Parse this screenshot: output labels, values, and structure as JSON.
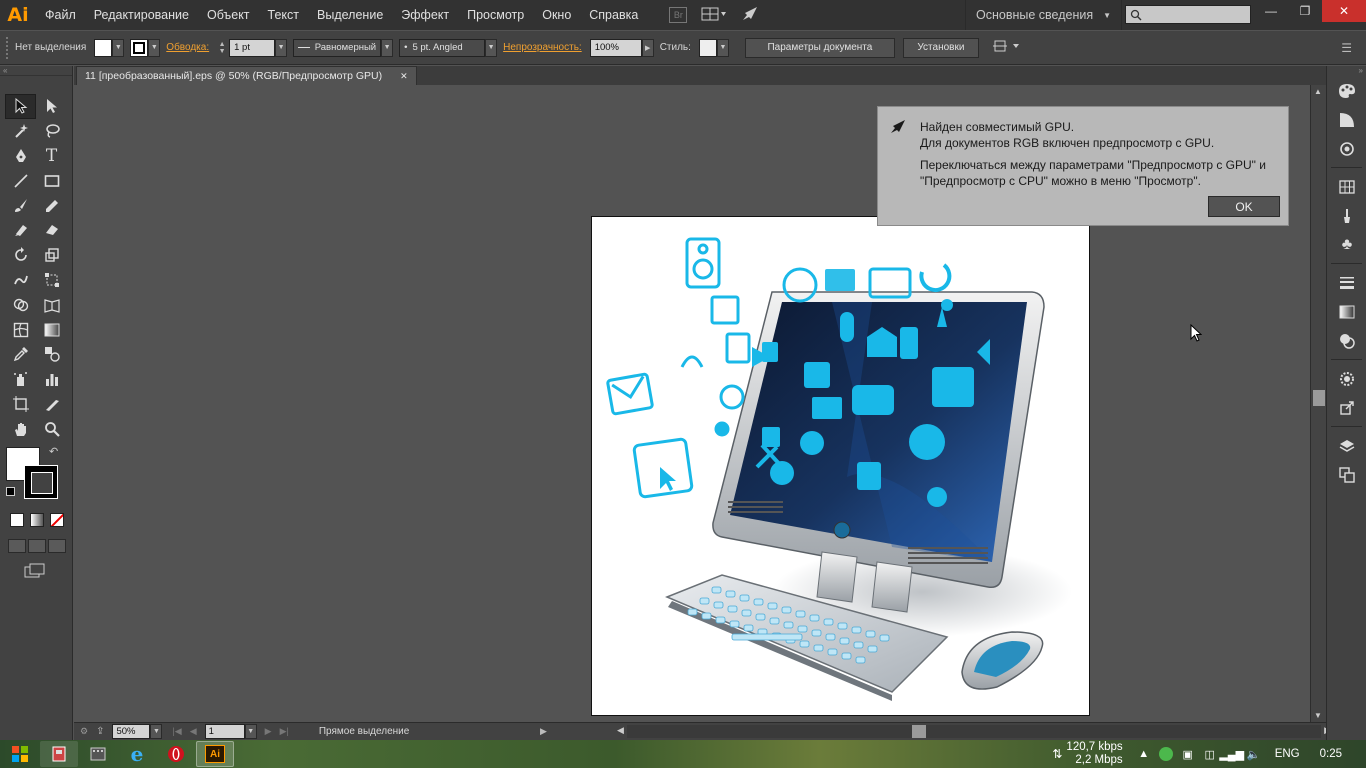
{
  "app": {
    "logo": "Ai",
    "menu": [
      "Файл",
      "Редактирование",
      "Объект",
      "Текст",
      "Выделение",
      "Эффект",
      "Просмотр",
      "Окно",
      "Справка"
    ],
    "bridge_label": "Br",
    "workspace": "Основные сведения",
    "window_buttons": {
      "minimize": "—",
      "restore": "❐",
      "close": "✕"
    }
  },
  "control": {
    "selection_label": "Нет выделения",
    "stroke_label": "Обводка:",
    "stroke_weight": "1 pt",
    "profile": "Равномерный",
    "brush": "5 pt. Angled",
    "opacity_label": "Непрозрачность:",
    "opacity": "100%",
    "style_label": "Стиль:",
    "doc_settings": "Параметры документа",
    "preferences": "Установки"
  },
  "document": {
    "tab_title": "11 [преобразованный].eps @ 50% (RGB/Предпросмотр GPU)",
    "tab_close": "✕"
  },
  "status": {
    "zoom": "50%",
    "page": "1",
    "tool_name": "Прямое выделение"
  },
  "gpu_dialog": {
    "line1": "Найден совместимый GPU.",
    "line2": "Для документов RGB включен предпросмотр с GPU.",
    "line3": "Переключаться между параметрами \"Предпросмотр с GPU\" и",
    "line4": "\"Предпросмотр с CPU\" можно в меню \"Просмотр\".",
    "ok": "OK"
  },
  "taskbar": {
    "net_down": "120,7 kbps",
    "net_up": "2,2 Mbps",
    "lang": "ENG",
    "time": "0:25"
  },
  "colors": {
    "accent_orange": "#ff9a00",
    "icon_cyan": "#19b8e8",
    "screen_blue": "#1e4f9c"
  }
}
